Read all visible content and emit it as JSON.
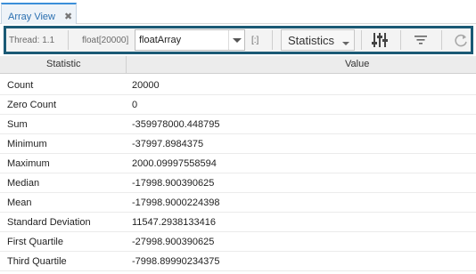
{
  "tab": {
    "title": "Array View",
    "close_glyph": "✖"
  },
  "toolbar": {
    "thread_label": "Thread: 1.1",
    "type_label": "float[20000]",
    "variable_value": "floatArray",
    "slice_label": "[:]",
    "view_mode": "Statistics",
    "icons": [
      "columns-settings-icon",
      "filter-icon",
      "refresh-icon"
    ]
  },
  "table": {
    "headers": [
      "Statistic",
      "Value"
    ],
    "rows": [
      {
        "statistic": "Count",
        "value": "20000"
      },
      {
        "statistic": "Zero Count",
        "value": "0"
      },
      {
        "statistic": "Sum",
        "value": "-359978000.448795"
      },
      {
        "statistic": "Minimum",
        "value": "-37997.8984375"
      },
      {
        "statistic": "Maximum",
        "value": "2000.09997558594"
      },
      {
        "statistic": "Median",
        "value": "-17998.900390625"
      },
      {
        "statistic": "Mean",
        "value": "-17998.9000224398"
      },
      {
        "statistic": "Standard Deviation",
        "value": "11547.2938133416"
      },
      {
        "statistic": "First Quartile",
        "value": "-27998.900390625"
      },
      {
        "statistic": "Third Quartile",
        "value": "-7998.89990234375"
      }
    ]
  },
  "colors": {
    "toolbar_border": "#1b5a75",
    "tab_accent": "#3b8fd9"
  }
}
